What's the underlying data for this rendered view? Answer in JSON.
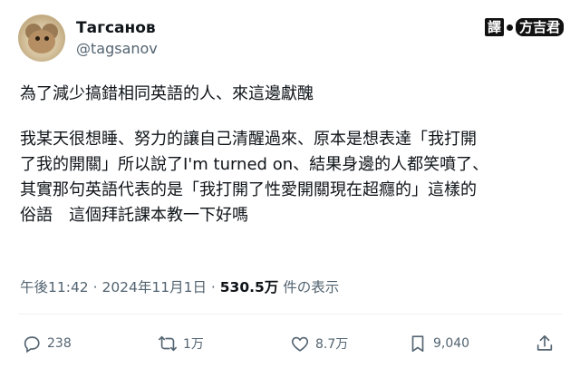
{
  "author": {
    "display_name": "Тагсанов",
    "handle": "@tagsanov"
  },
  "watermark": {
    "label_a": "譯",
    "label_b": "方吉君"
  },
  "tweet": {
    "paragraph1": "為了減少搞錯相同英語的人、來這邊獻醜",
    "paragraph2_lines": [
      "我某天很想睡、努力的讓自己清醒過來、原本是想表達「我打開",
      "了我的開關」所以說了I'm turned on、結果身邊的人都笑噴了、",
      "其實那句英語代表的是「我打開了性愛開關現在超癮的」這樣的",
      "俗語　這個拜託課本教一下好嗎"
    ]
  },
  "meta": {
    "time": "午後11:42",
    "sep1": " · ",
    "date": "2024年11月1日",
    "sep2": " · ",
    "views": "530.5万",
    "views_suffix": " 件の表示"
  },
  "actions": {
    "reply_count": "238",
    "retweet_count": "1万",
    "like_count": "8.7万",
    "bookmark_count": "9,040"
  },
  "icons": {
    "reply": "reply-icon",
    "retweet": "retweet-icon",
    "like": "heart-icon",
    "bookmark": "bookmark-icon",
    "share": "share-icon"
  },
  "colors": {
    "text": "#0f1419",
    "secondary": "#536471",
    "divider": "#eff3f4"
  }
}
